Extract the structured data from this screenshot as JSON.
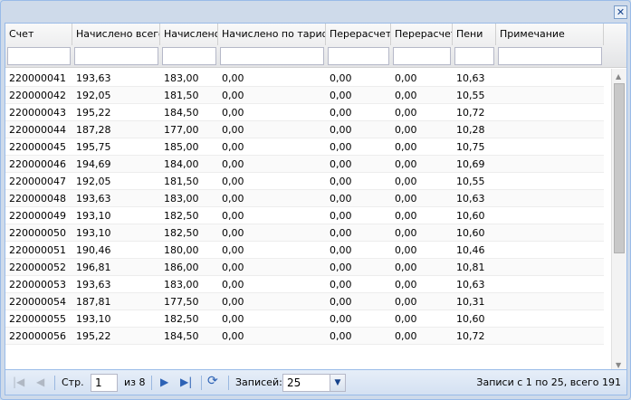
{
  "window": {
    "close_icon": "close-icon"
  },
  "columns": [
    "Счет",
    "Начислено всего",
    "Начислено",
    "Начислено по тарифу",
    "Перерасчет п",
    "Перерасчет",
    "Пени",
    "Примечание"
  ],
  "rows": [
    [
      "220000041",
      "193,63",
      "183,00",
      "0,00",
      "0,00",
      "0,00",
      "10,63",
      ""
    ],
    [
      "220000042",
      "192,05",
      "181,50",
      "0,00",
      "0,00",
      "0,00",
      "10,55",
      ""
    ],
    [
      "220000043",
      "195,22",
      "184,50",
      "0,00",
      "0,00",
      "0,00",
      "10,72",
      ""
    ],
    [
      "220000044",
      "187,28",
      "177,00",
      "0,00",
      "0,00",
      "0,00",
      "10,28",
      ""
    ],
    [
      "220000045",
      "195,75",
      "185,00",
      "0,00",
      "0,00",
      "0,00",
      "10,75",
      ""
    ],
    [
      "220000046",
      "194,69",
      "184,00",
      "0,00",
      "0,00",
      "0,00",
      "10,69",
      ""
    ],
    [
      "220000047",
      "192,05",
      "181,50",
      "0,00",
      "0,00",
      "0,00",
      "10,55",
      ""
    ],
    [
      "220000048",
      "193,63",
      "183,00",
      "0,00",
      "0,00",
      "0,00",
      "10,63",
      ""
    ],
    [
      "220000049",
      "193,10",
      "182,50",
      "0,00",
      "0,00",
      "0,00",
      "10,60",
      ""
    ],
    [
      "220000050",
      "193,10",
      "182,50",
      "0,00",
      "0,00",
      "0,00",
      "10,60",
      ""
    ],
    [
      "220000051",
      "190,46",
      "180,00",
      "0,00",
      "0,00",
      "0,00",
      "10,46",
      ""
    ],
    [
      "220000052",
      "196,81",
      "186,00",
      "0,00",
      "0,00",
      "0,00",
      "10,81",
      ""
    ],
    [
      "220000053",
      "193,63",
      "183,00",
      "0,00",
      "0,00",
      "0,00",
      "10,63",
      ""
    ],
    [
      "220000054",
      "187,81",
      "177,50",
      "0,00",
      "0,00",
      "0,00",
      "10,31",
      ""
    ],
    [
      "220000055",
      "193,10",
      "182,50",
      "0,00",
      "0,00",
      "0,00",
      "10,60",
      ""
    ],
    [
      "220000056",
      "195,22",
      "184,50",
      "0,00",
      "0,00",
      "0,00",
      "10,72",
      ""
    ]
  ],
  "pager": {
    "page_label": "Стр.",
    "page": "1",
    "of_label": "из 8",
    "records_label": "Записей:",
    "page_size": "25",
    "summary": "Записи с 1 по 25, всего 191"
  }
}
